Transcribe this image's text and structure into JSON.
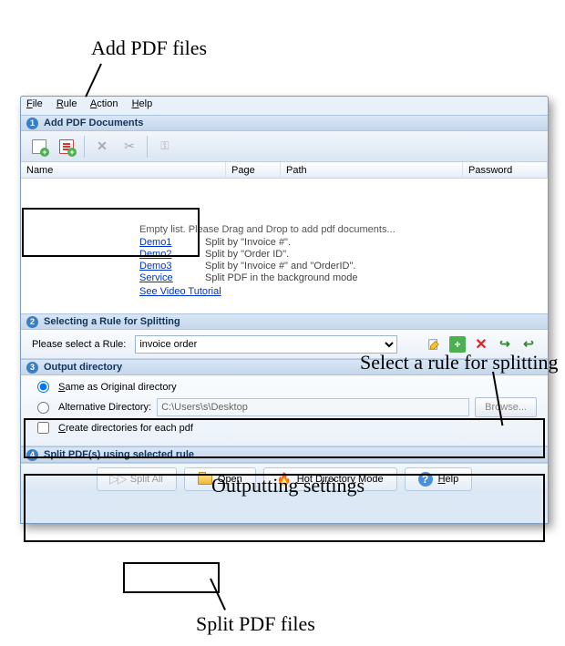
{
  "annotations": {
    "add_files": "Add PDF files",
    "select_rule": "Select a rule for splitting",
    "output_settings": "Outputting settings",
    "split_files": "Split PDF files"
  },
  "menu": {
    "file": "File",
    "rule": "Rule",
    "action": "Action",
    "help": "Help"
  },
  "sections": {
    "s1": "Add PDF Documents",
    "s2": "Selecting a Rule for Splitting",
    "s3": "Output directory",
    "s4": "Split PDF(s) using selected rule"
  },
  "columns": {
    "name": "Name",
    "page": "Page",
    "path": "Path",
    "password": "Password"
  },
  "empty": {
    "msg": "Empty list. Please Drag and Drop to add pdf documents...",
    "demos": [
      {
        "link": "Demo1",
        "desc": "Split by \"Invoice #\"."
      },
      {
        "link": "Demo2",
        "desc": "Split by \"Order ID\"."
      },
      {
        "link": "Demo3",
        "desc": "Split by \"Invoice #\" and \"OrderID\"."
      },
      {
        "link": "Service",
        "desc": "Split PDF in the background mode"
      }
    ],
    "video": "See Video Tutorial "
  },
  "rule": {
    "label": "Please select a Rule:",
    "selected": "invoice order"
  },
  "output": {
    "same": "Same as Original directory",
    "alt": "Alternative Directory:",
    "path": "C:\\Users\\s\\Desktop",
    "browse": "Browse...",
    "create_dirs": "Create directories for each pdf"
  },
  "buttons": {
    "split_all": "Split All",
    "open": "Open",
    "hot": "Hot Directory Mode",
    "help": "Help"
  }
}
